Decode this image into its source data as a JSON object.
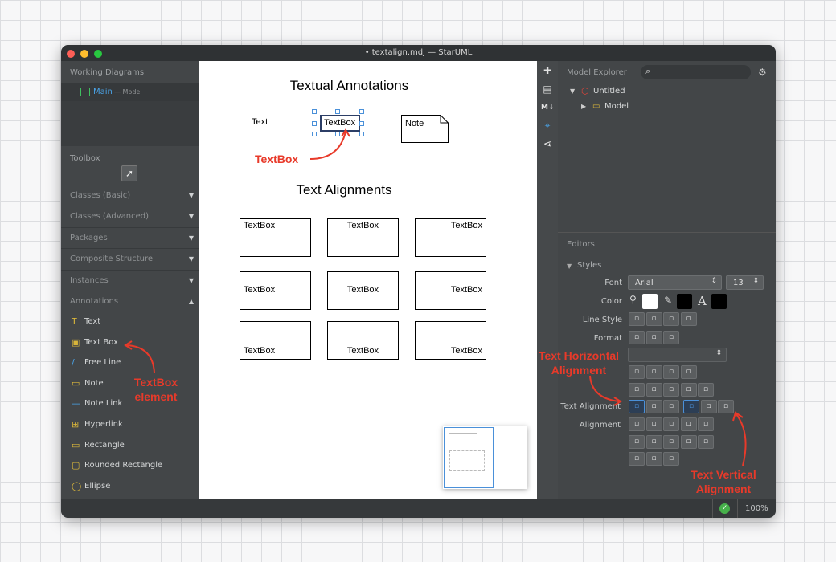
{
  "window": {
    "title": "• textalign.mdj — StarUML"
  },
  "working": {
    "title": "Working Diagrams",
    "item_name": "Main",
    "item_suffix": "— Model"
  },
  "toolbox": {
    "title": "Toolbox",
    "categories": [
      "Classes (Basic)",
      "Classes (Advanced)",
      "Packages",
      "Composite Structure",
      "Instances",
      "Annotations"
    ],
    "tools": [
      {
        "label": "Text",
        "icon": "text-tool-icon"
      },
      {
        "label": "Text Box",
        "icon": "textbox-tool-icon"
      },
      {
        "label": "Free Line",
        "icon": "freeline-tool-icon"
      },
      {
        "label": "Note",
        "icon": "note-tool-icon"
      },
      {
        "label": "Note Link",
        "icon": "notelink-tool-icon"
      },
      {
        "label": "Hyperlink",
        "icon": "hyperlink-tool-icon"
      },
      {
        "label": "Rectangle",
        "icon": "rectangle-tool-icon"
      },
      {
        "label": "Rounded Rectangle",
        "icon": "rounded-rectangle-tool-icon"
      },
      {
        "label": "Ellipse",
        "icon": "ellipse-tool-icon"
      }
    ]
  },
  "diagram": {
    "title1": "Textual Annotations",
    "text_label": "Text",
    "textbox_label": "TextBox",
    "note_label": "Note",
    "title2": "Text Alignments",
    "cell": "TextBox"
  },
  "model_explorer": {
    "title": "Model Explorer",
    "root": "Untitled",
    "child": "Model"
  },
  "editors": {
    "title": "Editors",
    "styles": "Styles",
    "font_label": "Font",
    "font_value": "Arial",
    "size_value": "13",
    "color_label": "Color",
    "line_style_label": "Line Style",
    "format_label": "Format",
    "text_alignment_label": "Text Alignment",
    "alignment_label": "Alignment",
    "color_letter": "A"
  },
  "status": {
    "zoom": "100%"
  },
  "annotations": {
    "textbox": "TextBox",
    "textbox_element": "TextBox\nelement",
    "horizontal": "Text Horizontal\nAlignment",
    "vertical": "Text Vertical\nAlignment"
  },
  "colors": {
    "accent_red": "#e83a2a",
    "selection_blue": "#4a90d9"
  }
}
